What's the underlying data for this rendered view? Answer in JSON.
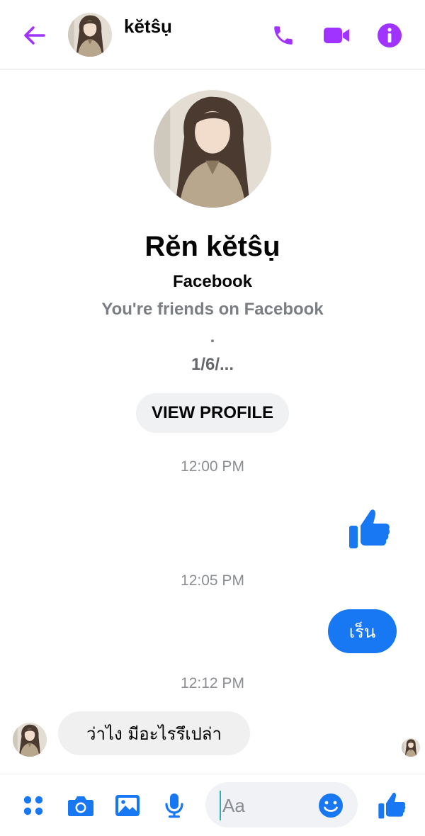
{
  "header": {
    "name": "kĕtŝụ",
    "colors": {
      "accent": "#a033ff"
    },
    "icons": [
      "back-arrow-icon",
      "phone-icon",
      "video-camera-icon",
      "info-icon"
    ]
  },
  "profile": {
    "name": "Rĕn kĕtŝụ",
    "source": "Facebook",
    "friends_text": "You're friends on Facebook",
    "dot": ".",
    "date_text": "1/6/...",
    "view_profile_label": "VIEW PROFILE"
  },
  "timestamps": [
    "12:00 PM",
    "12:05 PM",
    "12:12 PM"
  ],
  "messages": {
    "outgoing_text": "เร็น",
    "incoming_text": "ว่าไง มีอะไรรึเปล่า",
    "colors": {
      "outgoing_bubble": "#1877f2",
      "incoming_bubble": "#f0f0f0"
    }
  },
  "composer": {
    "placeholder": "Aa",
    "colors": {
      "icon": "#1877f2"
    },
    "icons": [
      "apps-icon",
      "camera-icon",
      "gallery-icon",
      "microphone-icon",
      "emoji-icon",
      "thumbs-up-icon"
    ]
  }
}
